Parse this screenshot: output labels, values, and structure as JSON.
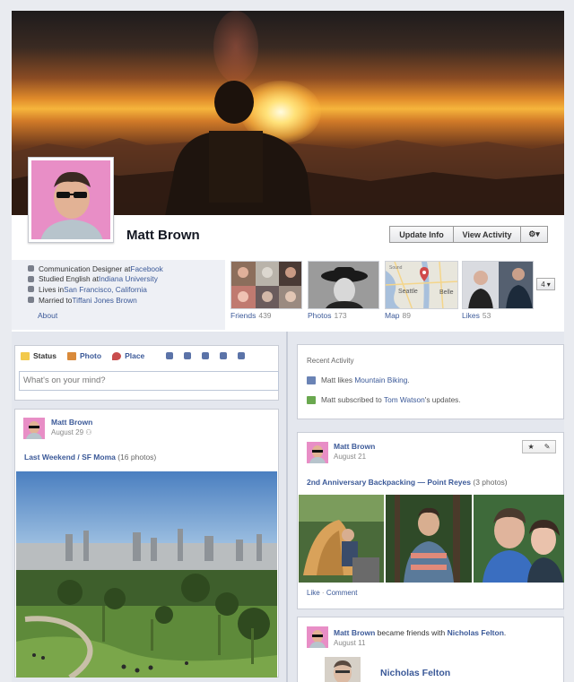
{
  "profile": {
    "name": "Matt Brown",
    "buttons": {
      "update_info": "Update Info",
      "view_activity": "View Activity",
      "gear": "⚙▾"
    },
    "info": [
      {
        "pre": "Communication Designer at ",
        "link": "Facebook"
      },
      {
        "pre": "Studied English at ",
        "link": "Indiana University"
      },
      {
        "pre": "Lives in ",
        "link": "San Francisco, California"
      },
      {
        "pre": "Married to ",
        "link": "Tiffani Jones Brown"
      }
    ],
    "about": "About"
  },
  "thumbs": [
    {
      "label": "Friends",
      "count": "439"
    },
    {
      "label": "Photos",
      "count": "173"
    },
    {
      "label": "Map",
      "count": "89"
    },
    {
      "label": "Likes",
      "count": "53"
    }
  ],
  "more": {
    "count": "4"
  },
  "map": {
    "seattle": "Seattle",
    "bellevue": "Belle",
    "sound": "Sound"
  },
  "composer": {
    "tabs": [
      "Status",
      "Photo",
      "Place"
    ],
    "placeholder": "What's on your mind?"
  },
  "post1": {
    "name": "Matt Brown",
    "date": "August 29",
    "title": "Last Weekend / SF Moma",
    "meta": "(16 photos)"
  },
  "recent": {
    "heading": "Recent Activity",
    "rows": [
      {
        "pre": "Matt likes ",
        "link": "Mountain Biking",
        "post": "."
      },
      {
        "pre": "Matt subscribed to ",
        "link": "Tom Watson",
        "post": "'s updates."
      }
    ]
  },
  "post2": {
    "name": "Matt Brown",
    "date": "August 21",
    "title": "2nd Anniversary Backpacking — Point Reyes",
    "meta": "(3 photos)",
    "like": "Like",
    "sep": "·",
    "comment": "Comment"
  },
  "post3": {
    "name": "Matt Brown",
    "mid": " became friends with ",
    "friend": "Nicholas Felton",
    "end": ".",
    "date": "August 11",
    "friend_title": "Nicholas Felton"
  },
  "colors": {
    "link": "#3b5998",
    "pink": "#e88ec6"
  }
}
